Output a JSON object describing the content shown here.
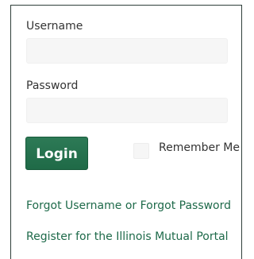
{
  "form": {
    "username_label": "Username",
    "username_value": "",
    "password_label": "Password",
    "password_value": "",
    "login_label": "Login",
    "remember_label": "Remember Me",
    "remember_checked": false
  },
  "links": {
    "forgot": "Forgot Username or Forgot Password",
    "register": "Register for the Illinois Mutual Portal"
  },
  "colors": {
    "accent": "#1f6a47",
    "link": "#1e6a4a",
    "field_bg": "#f6f6f6"
  }
}
